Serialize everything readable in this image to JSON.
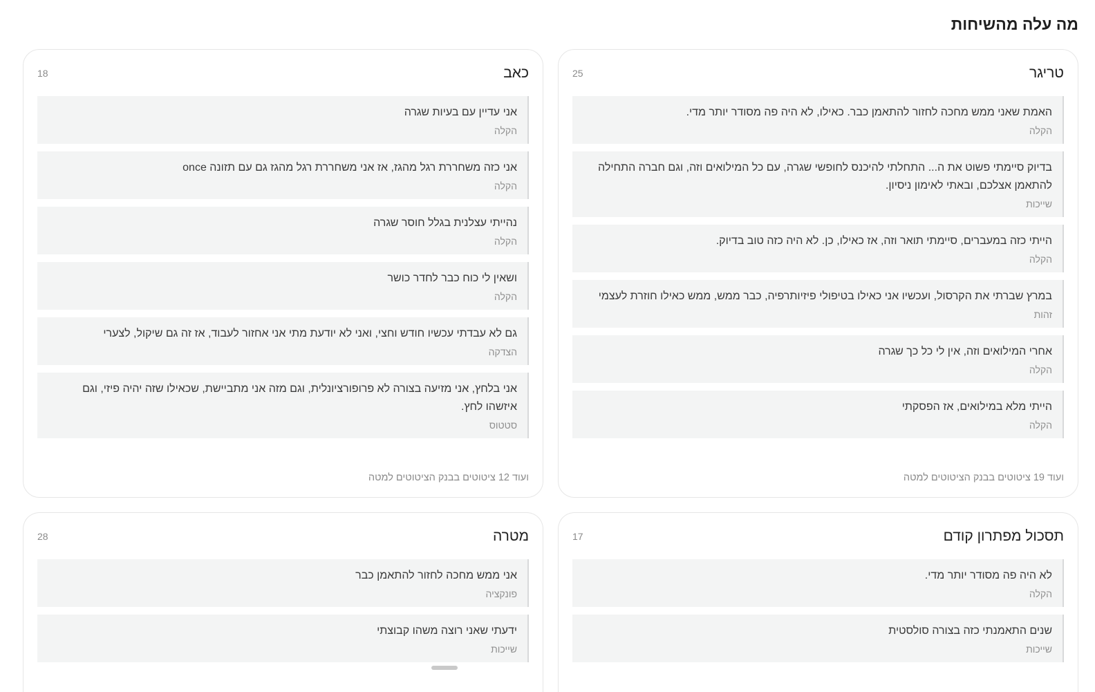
{
  "page": {
    "title": "מה עלה מהשיחות"
  },
  "cards": [
    {
      "title": "טריגר",
      "count": "25",
      "footer": "ועוד 19 ציטוטים בבנק הציטוטים למטה",
      "quotes": [
        {
          "text": "האמת שאני ממש מחכה לחזור להתאמן כבר. כאילו, לא היה פה מסודר יותר מדי.",
          "tag": "הקלה"
        },
        {
          "text": "בדיוק סיימתי פשוט את ה... התחלתי להיכנס לחופשי שגרה, עם כל המילואים וזה, וגם חברה התחילה להתאמן אצלכם, ובאתי לאימון ניסיון.",
          "tag": "שייכות"
        },
        {
          "text": "הייתי כזה במעברים, סיימתי תואר וזה, אז כאילו, כן. לא היה כזה טוב בדיוק.",
          "tag": "הקלה"
        },
        {
          "text": "במרץ שברתי את הקרסול, ועכשיו אני כאילו בטיפולי פיזיותרפיה, כבר ממש, ממש כאילו חוזרת לעצמי",
          "tag": "זהות"
        },
        {
          "text": "אחרי המילואים וזה, אין לי כל כך שגרה",
          "tag": "הקלה"
        },
        {
          "text": "הייתי מלא במילואים, אז הפסקתי",
          "tag": "הקלה"
        }
      ]
    },
    {
      "title": "כאב",
      "count": "18",
      "footer": "ועוד 12 ציטוטים בבנק הציטוטים למטה",
      "quotes": [
        {
          "text": "אני עדיין עם בעיות שגרה",
          "tag": "הקלה"
        },
        {
          "text": "אני כזה משחררת רגל מהגז, אז אני משחררת רגל מהגז גם עם תזונה once",
          "tag": "הקלה"
        },
        {
          "text": "נהייתי עצלנית בגלל חוסר שגרה",
          "tag": "הקלה"
        },
        {
          "text": "ושאין לי כוח כבר לחדר כושר",
          "tag": "הקלה"
        },
        {
          "text": "גם לא עבדתי עכשיו חודש וחצי, ואני לא יודעת מתי אני אחזור לעבוד, אז זה גם שיקול, לצערי",
          "tag": "הצדקה"
        },
        {
          "text": "אני בלחץ, אני מזיעה בצורה לא פרופורציונלית, וגם מזה אני מתביישת, שכאילו שזה יהיה פיזי, וגם איזשהו לחץ.",
          "tag": "סטטוס"
        }
      ]
    },
    {
      "title": "תסכול מפתרון קודם",
      "count": "17",
      "quotes": [
        {
          "text": "לא היה פה מסודר יותר מדי.",
          "tag": "הקלה"
        },
        {
          "text": "שנים התאמנתי כזה בצורה סולסטית",
          "tag": "שייכות"
        }
      ]
    },
    {
      "title": "מטרה",
      "count": "28",
      "quotes": [
        {
          "text": "אני ממש מחכה לחזור להתאמן כבר",
          "tag": "פונקציה"
        },
        {
          "text": "ידעתי שאני רוצה משהו קבוצתי",
          "tag": "שייכות"
        }
      ]
    }
  ]
}
